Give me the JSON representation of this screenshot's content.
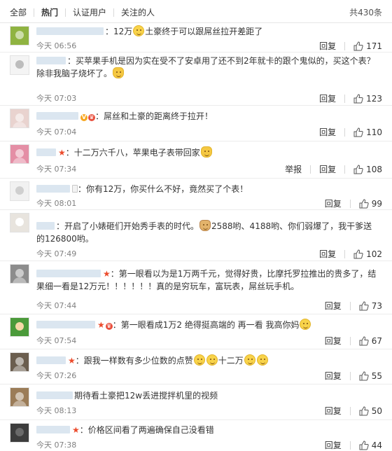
{
  "filters": {
    "tabs": [
      "全部",
      "热门",
      "认证用户",
      "关注的人"
    ],
    "active": "热门",
    "total": "共430条"
  },
  "actions_labels": {
    "reply": "回复",
    "report": "举报"
  },
  "comments": [
    {
      "before": "：12万",
      "after": "土豪终于可以跟屌丝拉开差距了",
      "time": "今天 06:56",
      "likes": "171"
    },
    {
      "before": "：买苹果手机是因为实在受不了安卓用了还不到2年就卡的跟个鬼似的，买这个表？除非我脑子烧坏了。",
      "after": "",
      "time": "今天 07:03",
      "likes": "123"
    },
    {
      "before": "：屌丝和土豪的距离终于拉开！",
      "after": "",
      "time": "今天 07:04",
      "likes": "110"
    },
    {
      "before": "：十二万六千八，苹果电子表带回家",
      "after": "",
      "time": "今天 07:34",
      "likes": "108"
    },
    {
      "before": "：你有12万，你买什么不好，竟然买了个表！",
      "after": "",
      "time": "今天 08:01",
      "likes": "99"
    },
    {
      "before": "：开启了小婊砸们开始秀手表的时代。",
      "after": "2588哟、4188哟、你们弱爆了，我干爹送的126800哟。",
      "time": "今天 07:49",
      "likes": "102"
    },
    {
      "before": "：第一眼看以为是1万两千元，觉得好贵，比摩托罗拉推出的贵多了，结果细一看是12万元！！！！！！真的是穷玩车，富玩表，屌丝玩手机。",
      "after": "",
      "time": "今天 07:44",
      "likes": "73"
    },
    {
      "before": "：第一眼看成1万2 绝得挺高端的 再一看 我高你妈",
      "after": "",
      "time": "今天 07:54",
      "likes": "67"
    },
    {
      "before": "：跟我一样数有多少位数的点赞",
      "middle": "十二万",
      "after": "",
      "time": "今天 07:26",
      "likes": "55"
    },
    {
      "before": "期待看土豪把12w丢进搅拌机里的视频",
      "after": "",
      "time": "今天 08:13",
      "likes": "50"
    },
    {
      "before": "：价格区间看了两遍确保自己没看错",
      "after": "",
      "time": "今天 07:38",
      "likes": "44"
    }
  ]
}
